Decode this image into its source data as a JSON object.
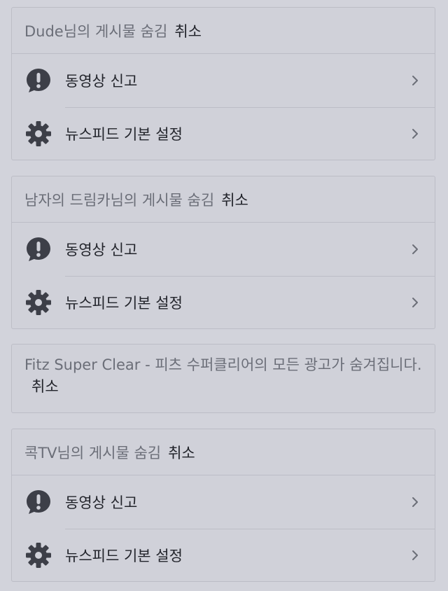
{
  "cards": [
    {
      "header": "Dude님의 게시물 숨김",
      "undo": "취소",
      "rows": [
        {
          "icon": "exclamation-bubble-icon",
          "label": "동영상 신고"
        },
        {
          "icon": "gear-icon",
          "label": "뉴스피드 기본 설정"
        }
      ]
    },
    {
      "header": "남자의 드림카님의 게시물 숨김",
      "undo": "취소",
      "rows": [
        {
          "icon": "exclamation-bubble-icon",
          "label": "동영상 신고"
        },
        {
          "icon": "gear-icon",
          "label": "뉴스피드 기본 설정"
        }
      ]
    },
    {
      "notice": "Fitz Super Clear - 피츠 수퍼클리어의 모든 광고가 숨겨집니다.",
      "undo": "취소"
    },
    {
      "header": "콕TV님의 게시물 숨김",
      "undo": "취소",
      "rows": [
        {
          "icon": "exclamation-bubble-icon",
          "label": "동영상 신고"
        },
        {
          "icon": "gear-icon",
          "label": "뉴스피드 기본 설정"
        }
      ]
    }
  ],
  "colors": {
    "background": "#d2d3db",
    "icon": "#3d3f48",
    "muted_text": "#6b6e78",
    "dark_text": "#1f2128"
  }
}
